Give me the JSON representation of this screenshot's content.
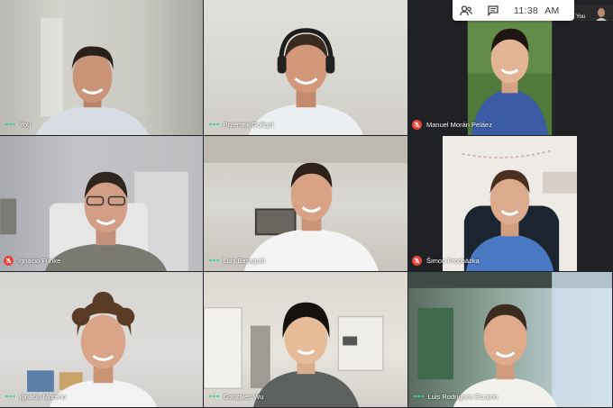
{
  "top_bar": {
    "people_icon": "people-icon",
    "chat_icon": "chat-icon",
    "time": "11:38",
    "ampm": "AM"
  },
  "self_view": {
    "label": "You"
  },
  "participants": [
    {
      "name": "You",
      "muted": false
    },
    {
      "name": "Przemek Gołfryd",
      "muted": false
    },
    {
      "name": "Manuel Morán Peláez",
      "muted": true
    },
    {
      "name": "Ignacio Funke",
      "muted": true
    },
    {
      "name": "Luis Basagoiti",
      "muted": false
    },
    {
      "name": "Šimon Procházka",
      "muted": true
    },
    {
      "name": "Ignacio Moreno",
      "muted": false
    },
    {
      "name": "Gonzales Wu",
      "muted": false
    },
    {
      "name": "Luis Rodríguez Escario",
      "muted": false
    }
  ],
  "colors": {
    "active_dots": "#34d399",
    "mute_badge": "#ea4335",
    "toolbar_bg": "#ffffff"
  }
}
